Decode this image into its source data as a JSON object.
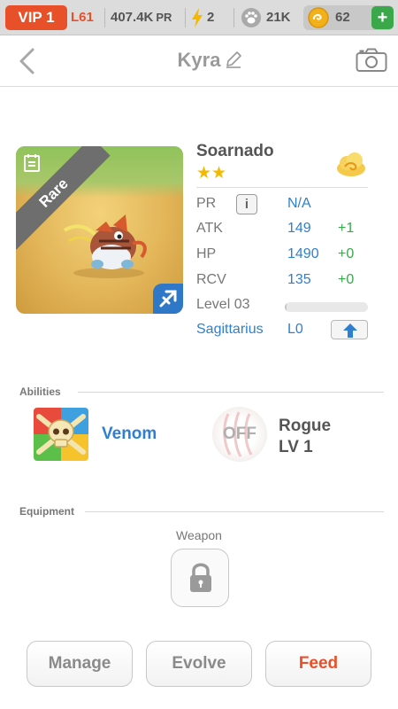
{
  "status_bar": {
    "vip": "VIP 1",
    "level": "L61",
    "pr_value": "407.4K",
    "pr_label": "PR",
    "energy": "2",
    "food": "21K",
    "gold": "62",
    "add_label": "+"
  },
  "header": {
    "title": "Kyra"
  },
  "pet": {
    "rarity": "Rare",
    "name": "Soarnado",
    "stars": "★★",
    "stats": {
      "pr": {
        "label": "PR",
        "value": "N/A",
        "info_label": "i"
      },
      "atk": {
        "label": "ATK",
        "value": "149",
        "bonus": "+1"
      },
      "hp": {
        "label": "HP",
        "value": "1490",
        "bonus": "+0"
      },
      "rcv": {
        "label": "RCV",
        "value": "135",
        "bonus": "+0"
      }
    },
    "level_label": "Level 03",
    "level_progress": 0.02,
    "zodiac": "Sagittarius",
    "zodiac_level": "L0"
  },
  "abilities": {
    "section_title": "Abilities",
    "ability_1": {
      "name": "Venom"
    },
    "ability_2": {
      "state": "OFF",
      "name": "Rogue",
      "level": "LV 1"
    }
  },
  "equipment": {
    "section_title": "Equipment",
    "slot_label": "Weapon"
  },
  "actions": {
    "manage": "Manage",
    "evolve": "Evolve",
    "feed": "Feed"
  },
  "colors": {
    "accent_orange": "#e8502a",
    "link_blue": "#2f7fd0",
    "bonus_green": "#3aa84a",
    "star_gold": "#f5b800"
  },
  "icons": {
    "back": "chevron-left-icon",
    "edit": "pencil-icon",
    "camera": "camera-icon",
    "energy": "lightning-icon",
    "food": "paw-icon",
    "gold": "coin-icon",
    "element": "cloud-icon",
    "upgrade": "arrow-up-icon",
    "lock": "lock-icon"
  }
}
